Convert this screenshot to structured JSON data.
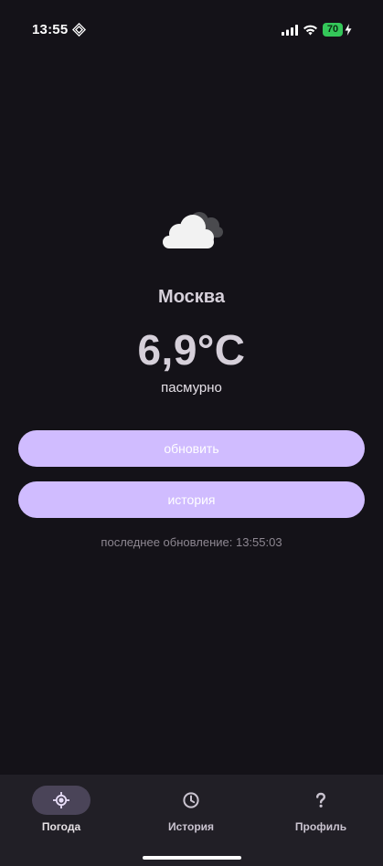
{
  "status_bar": {
    "time": "13:55",
    "battery_level": "70",
    "battery_color": "#34c759"
  },
  "weather": {
    "icon": "cloud-icon",
    "city": "Москва",
    "temperature": "6,9°C",
    "condition": "пасмурно"
  },
  "actions": {
    "refresh_label": "обновить",
    "history_label": "история",
    "accent_color": "#d0bcff"
  },
  "last_update": "последнее обновление: 13:55:03",
  "bottom_nav": {
    "items": [
      {
        "label": "Погода",
        "icon": "weather-location-icon",
        "active": true
      },
      {
        "label": "История",
        "icon": "clock-icon",
        "active": false
      },
      {
        "label": "Профиль",
        "icon": "question-mark-icon",
        "active": false
      }
    ]
  }
}
